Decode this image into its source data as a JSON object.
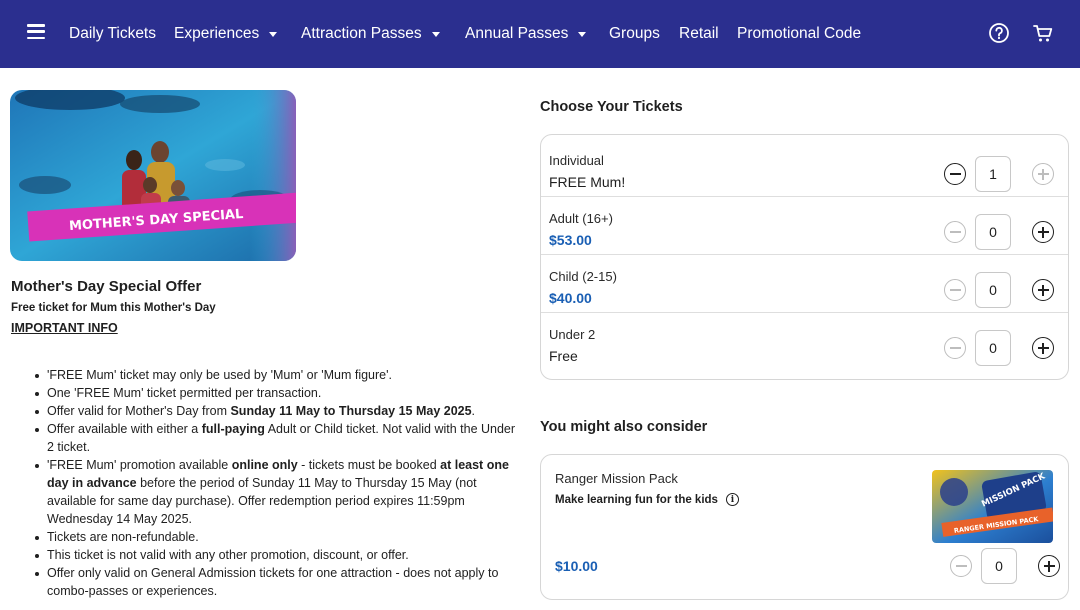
{
  "nav": {
    "items": [
      {
        "label": "Daily Tickets",
        "dropdown": false
      },
      {
        "label": "Experiences",
        "dropdown": true
      },
      {
        "label": "Attraction Passes",
        "dropdown": true
      },
      {
        "label": "Annual Passes",
        "dropdown": true
      },
      {
        "label": "Groups",
        "dropdown": false
      },
      {
        "label": "Retail",
        "dropdown": false
      },
      {
        "label": "Promotional Code",
        "dropdown": false
      }
    ],
    "icons": [
      "menu-icon",
      "help-icon",
      "cart-icon"
    ]
  },
  "offer": {
    "banner_text": "MOTHER'S DAY SPECIAL",
    "title": "Mother's Day Special Offer",
    "subtitle": "Free ticket for Mum this Mother's Day",
    "important_link": "IMPORTANT INFO",
    "info": [
      [
        {
          "t": "'FREE Mum' ticket may only be used by 'Mum' or 'Mum figure'."
        }
      ],
      [
        {
          "t": "One 'FREE Mum' ticket permitted per transaction."
        }
      ],
      [
        {
          "t": "Offer valid for Mother's Day from "
        },
        {
          "t": "Sunday 11 May to Thursday 15 May 2025",
          "b": true
        },
        {
          "t": "."
        }
      ],
      [
        {
          "t": "Offer available with either a "
        },
        {
          "t": "full-paying",
          "b": true
        },
        {
          "t": " Adult or Child ticket. Not valid with the Under 2 ticket."
        }
      ],
      [
        {
          "t": "'FREE Mum' promotion available "
        },
        {
          "t": "online only",
          "b": true
        },
        {
          "t": " - tickets must be booked "
        },
        {
          "t": "at least one day in advance",
          "b": true
        },
        {
          "t": " before the period of Sunday 11 May to Thursday 15 May (not available for same day purchase). Offer redemption period expires 11:59pm Wednesday 14 May 2025."
        }
      ],
      [
        {
          "t": "Tickets are non-refundable."
        }
      ],
      [
        {
          "t": "This ticket is not valid with any other promotion, discount, or offer."
        }
      ],
      [
        {
          "t": "Offer only valid on General Admission tickets for one attraction - does not apply to combo-passes or experiences."
        }
      ]
    ]
  },
  "tickets": {
    "title": "Choose Your Tickets",
    "rows": [
      {
        "label": "Individual",
        "price": "FREE Mum!",
        "price_blue": false,
        "qty": "1",
        "minus_enabled": true,
        "plus_enabled": false
      },
      {
        "label": "Adult (16+)",
        "price": "$53.00",
        "price_blue": true,
        "qty": "0",
        "minus_enabled": false,
        "plus_enabled": true
      },
      {
        "label": "Child (2-15)",
        "price": "$40.00",
        "price_blue": true,
        "qty": "0",
        "minus_enabled": false,
        "plus_enabled": true
      },
      {
        "label": "Under 2",
        "price": "Free",
        "price_blue": false,
        "qty": "0",
        "minus_enabled": false,
        "plus_enabled": true
      }
    ]
  },
  "addons": {
    "title": "You might also consider",
    "item": {
      "name": "Ranger Mission Pack",
      "desc": "Make learning fun for the kids",
      "price": "$10.00",
      "qty": "0",
      "image_text_top": "MISSION PACK",
      "image_text_banner": "RANGER MISSION PACK"
    }
  },
  "colors": {
    "nav_bg": "#2b2f8f",
    "price_blue": "#1a5fb4",
    "banner_pink": "#d832b8"
  }
}
